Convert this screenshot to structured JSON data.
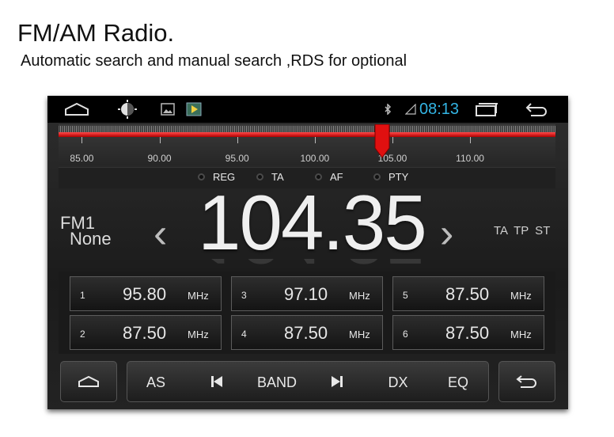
{
  "caption": {
    "title": "FM/AM Radio.",
    "subtitle": "Automatic search and manual search ,RDS for optional"
  },
  "status_bar": {
    "time": "08:13",
    "time_color": "#33b5e5",
    "icons": [
      "home-icon",
      "brightness-icon",
      "gallery-icon",
      "play-store-icon",
      "bluetooth-icon",
      "signal-icon",
      "recent-apps-icon",
      "back-icon"
    ]
  },
  "tuner": {
    "current_frequency": 104.35,
    "range": [
      83.5,
      115.5
    ],
    "needle_color": "#e01010",
    "labels": [
      "85.00",
      "90.00",
      "95.00",
      "100.00",
      "105.00",
      "110.00"
    ]
  },
  "rds": {
    "options": [
      "REG",
      "TA",
      "AF",
      "PTY"
    ]
  },
  "display": {
    "band": "FM1",
    "station": "None",
    "frequency": "104.35",
    "flags": "TA TP ST",
    "prev_symbol": "‹",
    "next_symbol": "›"
  },
  "presets": [
    {
      "num": "1",
      "freq": "95.80",
      "unit": "MHz"
    },
    {
      "num": "3",
      "freq": "97.10",
      "unit": "MHz"
    },
    {
      "num": "5",
      "freq": "87.50",
      "unit": "MHz"
    },
    {
      "num": "2",
      "freq": "87.50",
      "unit": "MHz"
    },
    {
      "num": "4",
      "freq": "87.50",
      "unit": "MHz"
    },
    {
      "num": "6",
      "freq": "87.50",
      "unit": "MHz"
    }
  ],
  "bottom_bar": {
    "as": "AS",
    "band": "BAND",
    "dx": "DX",
    "eq": "EQ"
  }
}
